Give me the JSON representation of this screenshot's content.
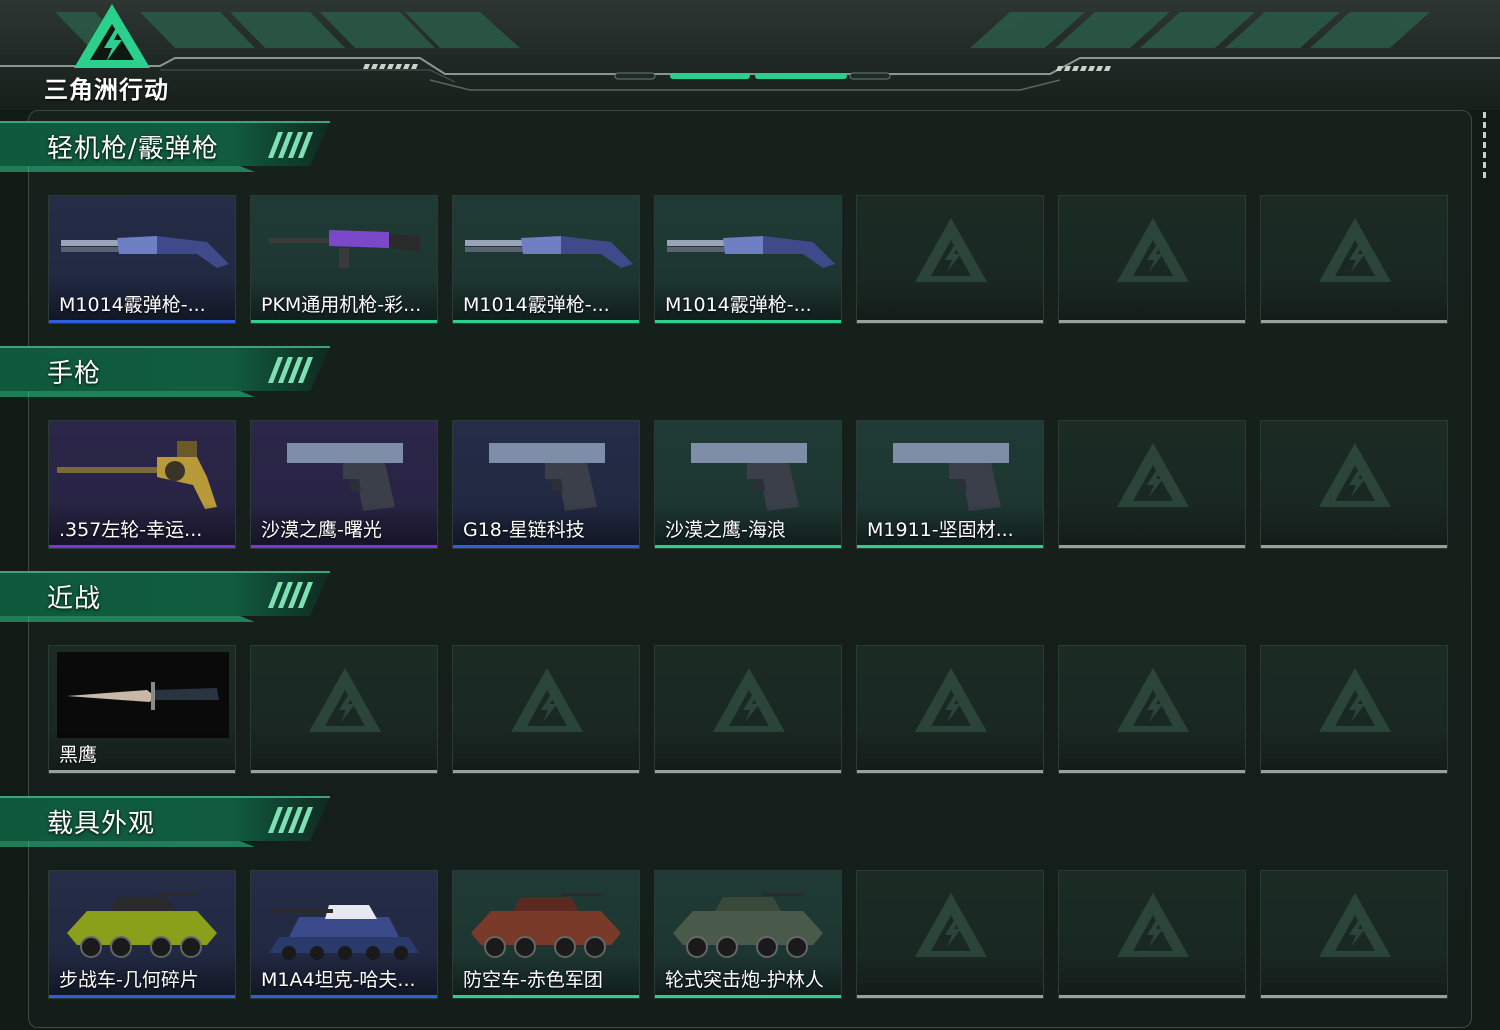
{
  "app": {
    "logo_text": "三角洲行动"
  },
  "colors": {
    "accent": "#2ad08c",
    "rarity_blue": "#2f5fe0",
    "rarity_green": "#2ad08c",
    "rarity_purple": "#7a35e0",
    "empty": "#9aa19d"
  },
  "sections": [
    {
      "title": "轻机枪/霰弹枪",
      "items": [
        {
          "label": "M1014霰弹枪-...",
          "rarity": "blue",
          "icon": "shotgun-icon"
        },
        {
          "label": "PKM通用机枪-彩...",
          "rarity": "green",
          "icon": "machine-gun-icon"
        },
        {
          "label": "M1014霰弹枪-...",
          "rarity": "green",
          "icon": "shotgun-icon"
        },
        {
          "label": "M1014霰弹枪-...",
          "rarity": "green",
          "icon": "shotgun-icon"
        },
        {
          "label": "",
          "rarity": "empty"
        },
        {
          "label": "",
          "rarity": "empty"
        },
        {
          "label": "",
          "rarity": "empty"
        }
      ]
    },
    {
      "title": "手枪",
      "items": [
        {
          "label": ".357左轮-幸运...",
          "rarity": "purple",
          "icon": "revolver-icon"
        },
        {
          "label": "沙漠之鹰-曙光",
          "rarity": "purple",
          "icon": "pistol-icon"
        },
        {
          "label": "G18-星链科技",
          "rarity": "blue",
          "icon": "pistol-icon"
        },
        {
          "label": "沙漠之鹰-海浪",
          "rarity": "green",
          "icon": "pistol-icon"
        },
        {
          "label": "M1911-坚固材...",
          "rarity": "green",
          "icon": "pistol-icon"
        },
        {
          "label": "",
          "rarity": "empty"
        },
        {
          "label": "",
          "rarity": "empty"
        }
      ]
    },
    {
      "title": "近战",
      "items": [
        {
          "label": "黑鹰",
          "rarity": "empty",
          "icon": "knife-icon"
        },
        {
          "label": "",
          "rarity": "empty"
        },
        {
          "label": "",
          "rarity": "empty"
        },
        {
          "label": "",
          "rarity": "empty"
        },
        {
          "label": "",
          "rarity": "empty"
        },
        {
          "label": "",
          "rarity": "empty"
        },
        {
          "label": "",
          "rarity": "empty"
        }
      ]
    },
    {
      "title": "载具外观",
      "items": [
        {
          "label": "步战车-几何碎片",
          "rarity": "blue",
          "icon": "ifv-icon"
        },
        {
          "label": "M1A4坦克-哈夫...",
          "rarity": "blue",
          "icon": "tank-icon"
        },
        {
          "label": "防空车-赤色军团",
          "rarity": "green",
          "icon": "aa-vehicle-icon"
        },
        {
          "label": "轮式突击炮-护林人",
          "rarity": "green",
          "icon": "assault-gun-icon"
        },
        {
          "label": "",
          "rarity": "empty"
        },
        {
          "label": "",
          "rarity": "empty"
        },
        {
          "label": "",
          "rarity": "empty"
        }
      ]
    }
  ]
}
